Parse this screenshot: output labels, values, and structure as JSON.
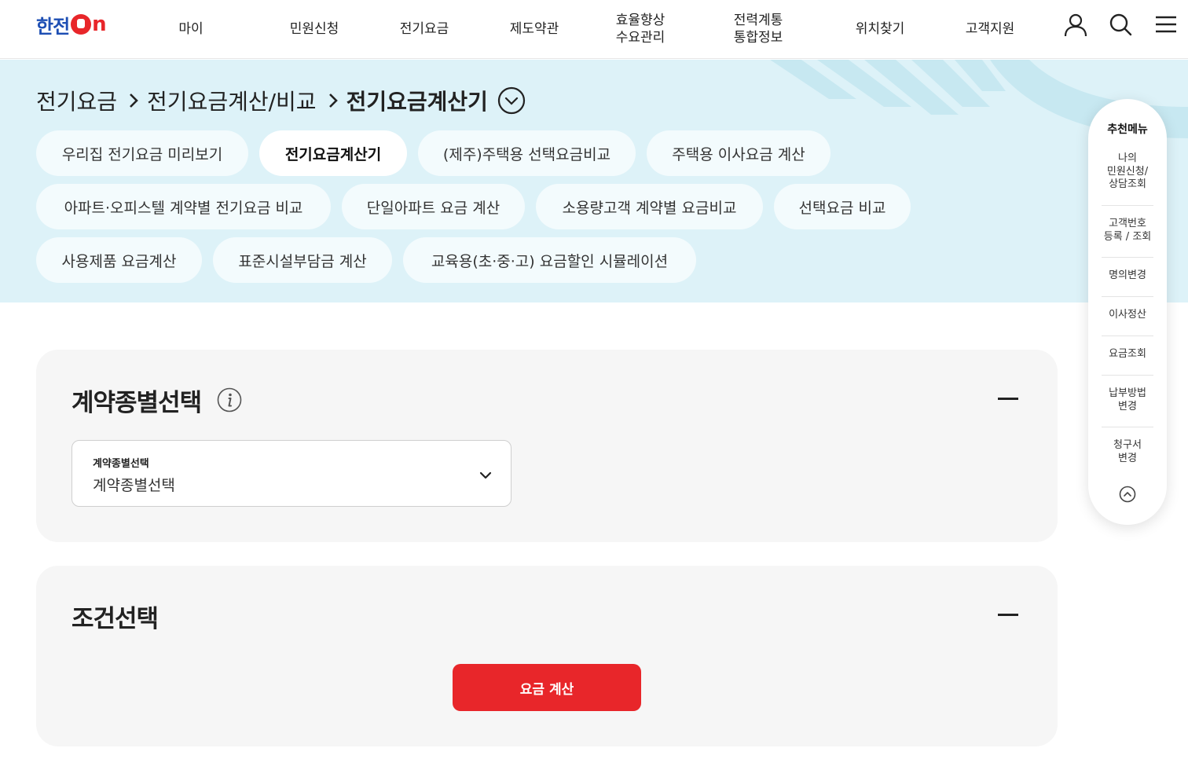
{
  "header": {
    "logo_text": "한전",
    "logo_suffix": "n",
    "nav": [
      "마이",
      "민원신청",
      "전기요금",
      "제도약관",
      "효율향상\n수요관리",
      "전력계통\n통합정보",
      "위치찾기",
      "고객지원"
    ],
    "icons": [
      "user-icon",
      "search-icon",
      "menu-icon"
    ]
  },
  "breadcrumb": {
    "items": [
      "전기요금",
      "전기요금계산/비교"
    ],
    "current": "전기요금계산기"
  },
  "chips": [
    {
      "label": "우리집 전기요금 미리보기",
      "active": false
    },
    {
      "label": "전기요금계산기",
      "active": true
    },
    {
      "label": "(제주)주택용 선택요금비교",
      "active": false
    },
    {
      "label": "주택용 이사요금 계산",
      "active": false
    },
    {
      "label": "아파트·오피스텔 계약별 전기요금 비교",
      "active": false
    },
    {
      "label": "단일아파트 요금 계산",
      "active": false
    },
    {
      "label": "소용량고객 계약별 요금비교",
      "active": false
    },
    {
      "label": "선택요금 비교",
      "active": false
    },
    {
      "label": "사용제품 요금계산",
      "active": false
    },
    {
      "label": "표준시설부담금 계산",
      "active": false
    },
    {
      "label": "교육용(초·중·고) 요금할인 시뮬레이션",
      "active": false
    }
  ],
  "contract_section": {
    "title": "계약종별선택",
    "select": {
      "label": "계약종별선택",
      "value": "계약종별선택"
    }
  },
  "condition_section": {
    "title": "조건선택",
    "button": "요금 계산"
  },
  "quick_menu": {
    "title": "추천메뉴",
    "items": [
      "나의\n민원신청/\n상담조회",
      "고객번호\n등록 / 조회",
      "명의변경",
      "이사정산",
      "요금조회",
      "납부방법\n변경",
      "청구서\n변경"
    ]
  },
  "colors": {
    "brand_blue": "#1e4fb4",
    "brand_red": "#e8262a",
    "banner_bg": "#ddf2f8"
  }
}
